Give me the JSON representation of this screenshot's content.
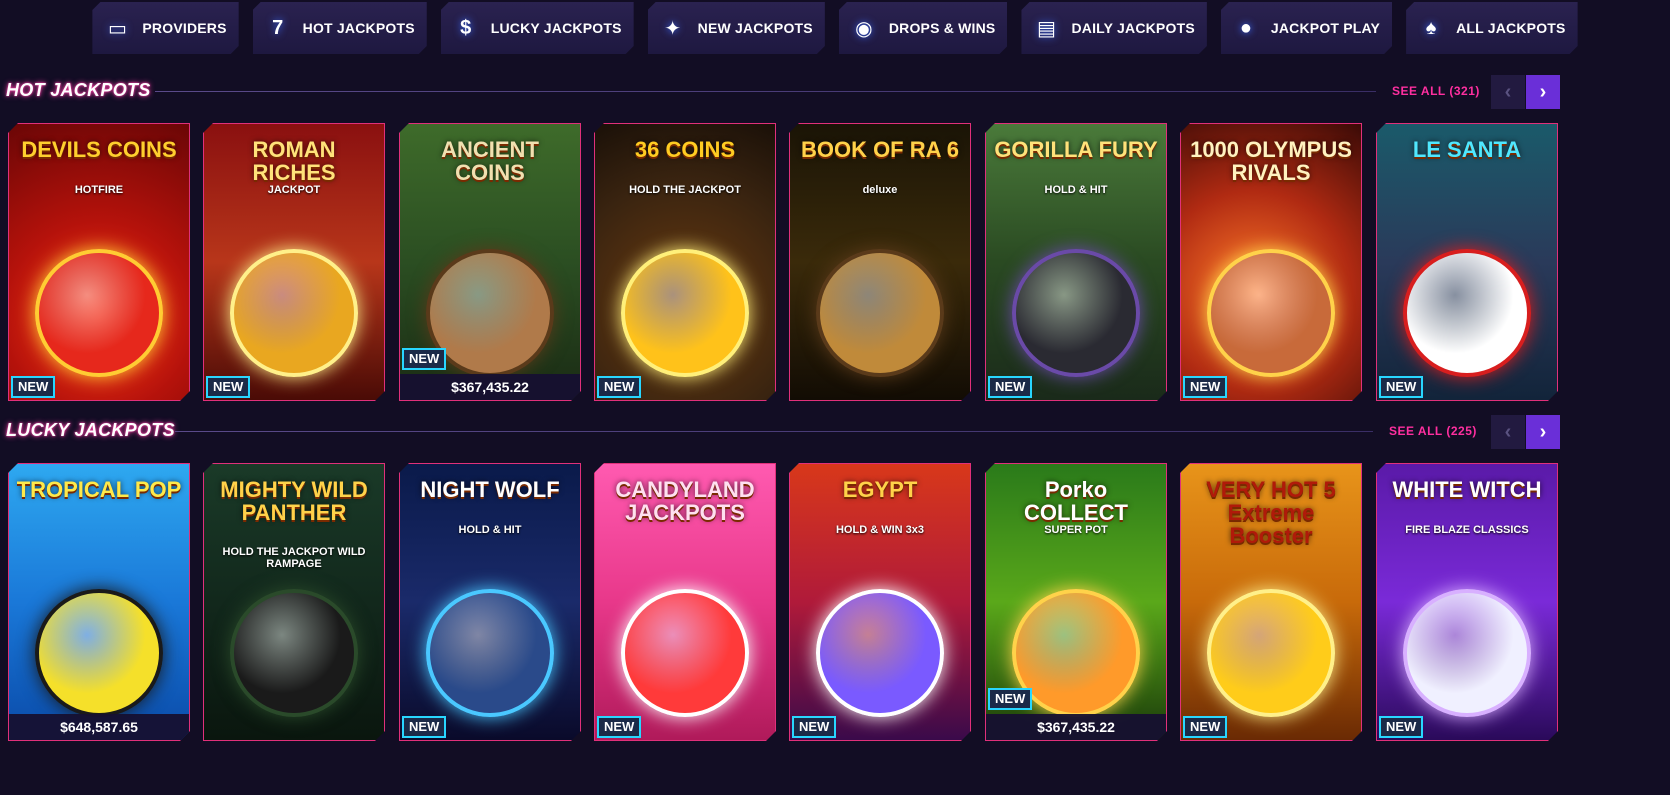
{
  "nav": [
    {
      "label": "PROVIDERS",
      "icon": "folder-icon",
      "glyph": "▭"
    },
    {
      "label": "HOT JACKPOTS",
      "icon": "seven-icon",
      "glyph": "7"
    },
    {
      "label": "LUCKY JACKPOTS",
      "icon": "money-bag-icon",
      "glyph": "$"
    },
    {
      "label": "NEW JACKPOTS",
      "icon": "sparkles-icon",
      "glyph": "✦"
    },
    {
      "label": "DROPS & WINS",
      "icon": "drops-wins-icon",
      "glyph": "◉"
    },
    {
      "label": "DAILY JACKPOTS",
      "icon": "calendar-icon",
      "glyph": "▤"
    },
    {
      "label": "JACKPOT PLAY",
      "icon": "bomb-icon",
      "glyph": "●"
    },
    {
      "label": "ALL JACKPOTS",
      "icon": "card-suits-icon",
      "glyph": "♠"
    }
  ],
  "sections": [
    {
      "title": "HOT JACKPOTS",
      "see_all": "SEE ALL (321)",
      "arrows": {
        "prev": "‹",
        "next": "›"
      },
      "games": [
        {
          "name": "DEVILS COINS",
          "subtitle": "HOTFIRE",
          "badge": "NEW",
          "prize": null,
          "theme": "devil"
        },
        {
          "name": "ROMAN RICHES",
          "subtitle": "JACKPOT",
          "badge": "NEW",
          "prize": null,
          "theme": "roman"
        },
        {
          "name": "ANCIENT COINS",
          "subtitle": "",
          "badge": "NEW",
          "prize": "$367,435.22",
          "theme": "ancient"
        },
        {
          "name": "36 COINS",
          "subtitle": "HOLD THE JACKPOT",
          "badge": "NEW",
          "prize": null,
          "theme": "coins36"
        },
        {
          "name": "BOOK OF RA 6",
          "subtitle": "deluxe",
          "badge": null,
          "prize": null,
          "theme": "bookofra"
        },
        {
          "name": "GORILLA FURY",
          "subtitle": "HOLD & HIT",
          "badge": "NEW",
          "prize": null,
          "theme": "gorilla"
        },
        {
          "name": "1000 OLYMPUS RIVALS",
          "subtitle": "",
          "badge": "NEW",
          "prize": null,
          "theme": "olympus"
        },
        {
          "name": "LE SANTA",
          "subtitle": "",
          "badge": "NEW",
          "prize": null,
          "theme": "santa"
        }
      ]
    },
    {
      "title": "LUCKY JACKPOTS",
      "see_all": "SEE ALL (225)",
      "arrows": {
        "prev": "‹",
        "next": "›"
      },
      "games": [
        {
          "name": "TROPICAL POP",
          "subtitle": "",
          "badge": null,
          "prize": "$648,587.65",
          "theme": "tropical"
        },
        {
          "name": "MIGHTY WILD PANTHER",
          "subtitle": "HOLD THE JACKPOT WILD RAMPAGE",
          "badge": null,
          "prize": null,
          "theme": "panther"
        },
        {
          "name": "NIGHT WOLF",
          "subtitle": "HOLD & HIT",
          "badge": "NEW",
          "prize": null,
          "theme": "wolf"
        },
        {
          "name": "CANDYLAND JACKPOTS",
          "subtitle": "",
          "badge": "NEW",
          "prize": null,
          "theme": "candy"
        },
        {
          "name": "EGYPT",
          "subtitle": "HOLD & WIN 3x3",
          "badge": "NEW",
          "prize": null,
          "theme": "egypt"
        },
        {
          "name": "Porko COLLECT",
          "subtitle": "SUPER POT",
          "badge": "NEW",
          "prize": "$367,435.22",
          "theme": "porko"
        },
        {
          "name": "VERY HOT 5 Extreme Booster",
          "subtitle": "",
          "badge": "NEW",
          "prize": null,
          "theme": "veryhot"
        },
        {
          "name": "WHITE WITCH",
          "subtitle": "FIRE BLAZE CLASSICS",
          "badge": "NEW",
          "prize": null,
          "theme": "witch"
        }
      ]
    }
  ]
}
